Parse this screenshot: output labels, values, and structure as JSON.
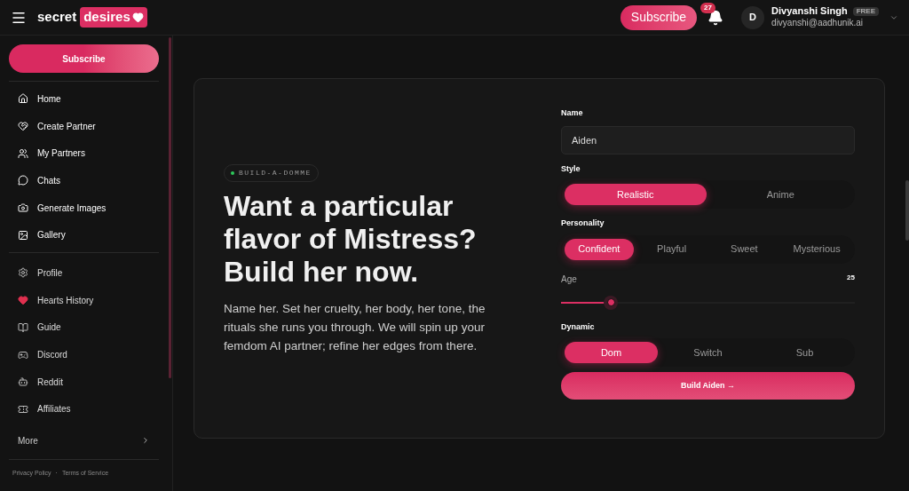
{
  "header": {
    "logo_word": "secret",
    "logo_badge": "desires",
    "subscribe": "Subscribe",
    "notifications": "27",
    "user": {
      "initial": "D",
      "name": "Divyanshi Singh",
      "plan": "FREE",
      "email": "divyanshi@aadhunik.ai"
    }
  },
  "sidebar": {
    "subscribe": "Subscribe",
    "primary": [
      {
        "label": "Home"
      },
      {
        "label": "Create Partner"
      },
      {
        "label": "My Partners"
      },
      {
        "label": "Chats"
      },
      {
        "label": "Generate Images"
      },
      {
        "label": "Gallery"
      }
    ],
    "secondary": [
      {
        "label": "Profile"
      },
      {
        "label": "Hearts History"
      },
      {
        "label": "Guide"
      },
      {
        "label": "Discord"
      },
      {
        "label": "Reddit"
      },
      {
        "label": "Affiliates"
      }
    ],
    "more": "More",
    "footer": [
      "Privacy Policy",
      "·",
      "Terms of Service"
    ]
  },
  "hero": {
    "tag": "BUILD-A-DOMME",
    "title": "Want a particular flavor of Mistress? Build her now.",
    "body": "Name her. Set her cruelty, her body, her tone, the rituals she runs you through. We will spin up your femdom AI partner; refine her edges from there."
  },
  "form": {
    "name_label": "Name",
    "name_value": "Aiden",
    "style_label": "Style",
    "style": [
      {
        "label": "Realistic",
        "selected": true
      },
      {
        "label": "Anime",
        "selected": false
      }
    ],
    "personality_label": "Personality",
    "personality": [
      {
        "label": "Confident",
        "selected": true
      },
      {
        "label": "Playful",
        "selected": false
      },
      {
        "label": "Sweet",
        "selected": false
      },
      {
        "label": "Mysterious",
        "selected": false
      }
    ],
    "age_label": "Age",
    "age_value": "25",
    "age_slider": {
      "level": 0.17
    },
    "dynamic_label": "Dynamic",
    "dynamic": [
      {
        "label": "Dom",
        "selected": true
      },
      {
        "label": "Switch",
        "selected": false
      },
      {
        "label": "Sub",
        "selected": false
      }
    ],
    "submit": "Build Aiden →"
  }
}
